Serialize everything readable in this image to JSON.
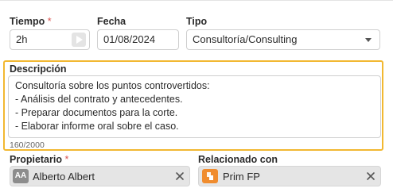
{
  "tiempo": {
    "label": "Tiempo",
    "required_mark": "*",
    "value": "2h"
  },
  "fecha": {
    "label": "Fecha",
    "value": "01/08/2024"
  },
  "tipo": {
    "label": "Tipo",
    "value": "Consultoría/Consulting"
  },
  "descripcion": {
    "label": "Descripción",
    "lines": [
      "Consultoría sobre los puntos controvertidos:",
      "- Análisis del contrato y antecedentes.",
      "- Preparar documentos para la corte.",
      "- Elaborar informe oral sobre el caso."
    ],
    "counter": "160/2000"
  },
  "propietario": {
    "label": "Propietario",
    "required_mark": "*",
    "initials": "AA",
    "value": "Alberto Albert"
  },
  "relacionado": {
    "label": "Relacionado con",
    "value": "Prim FP"
  },
  "colors": {
    "focus_border": "#f2b831",
    "required": "#d9534f",
    "chip_bg": "#e5e5e5",
    "doc_icon": "#f08c2e"
  }
}
